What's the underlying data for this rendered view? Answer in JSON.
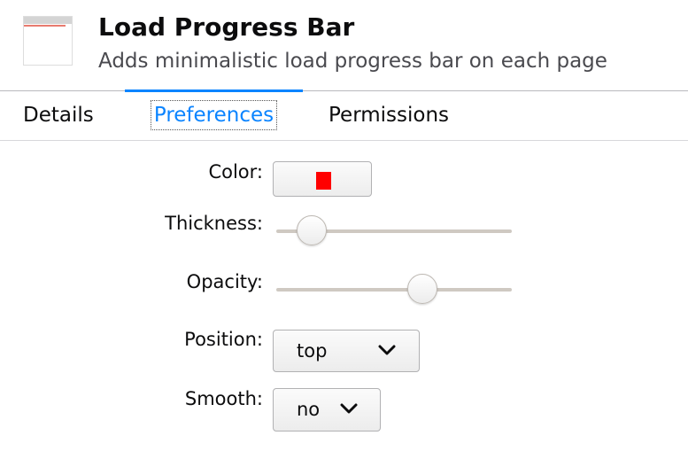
{
  "addon": {
    "title": "Load Progress Bar",
    "description": "Adds minimalistic load progress bar on each page",
    "icon": "load-progress-bar-icon"
  },
  "tabs": [
    {
      "label": "Details",
      "selected": false
    },
    {
      "label": "Preferences",
      "selected": true
    },
    {
      "label": "Permissions",
      "selected": false
    }
  ],
  "preferences": {
    "color": {
      "label": "Color:",
      "value": "#ff0000"
    },
    "thickness": {
      "label": "Thickness:",
      "value_fraction": 0.1
    },
    "opacity": {
      "label": "Opacity:",
      "value_fraction": 0.64
    },
    "position": {
      "label": "Position:",
      "value": "top"
    },
    "smooth": {
      "label": "Smooth:",
      "value": "no"
    }
  },
  "colors": {
    "accent": "#0a84ff",
    "text": "#0c0c0d",
    "secondary_text": "#4a4a4f"
  }
}
